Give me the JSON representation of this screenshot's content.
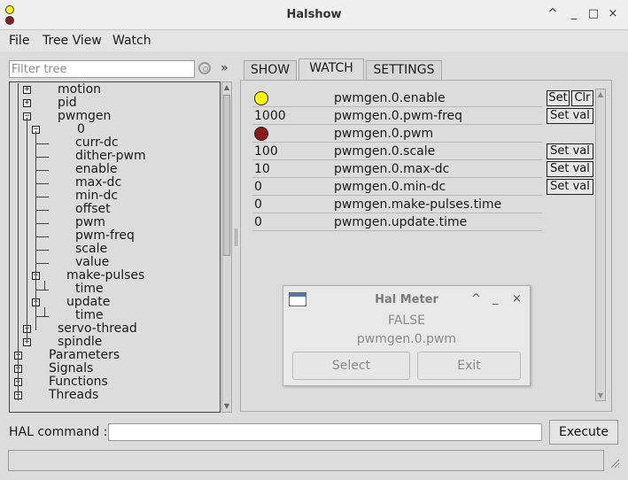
{
  "window": {
    "title": "Halshow",
    "controls": {
      "minimize": "^",
      "restore": "_",
      "maximize": "□",
      "close": "×"
    }
  },
  "menu": {
    "file": "File",
    "tree_view": "Tree View",
    "watch": "Watch"
  },
  "filter": {
    "placeholder": "Filter tree",
    "expand_glyph": "»"
  },
  "tree": [
    {
      "label": "motion",
      "expander": "+"
    },
    {
      "label": "pid",
      "expander": "+"
    },
    {
      "label": "pwmgen",
      "expander": "−"
    },
    {
      "label": "0",
      "expander": "−"
    },
    {
      "label": "curr-dc"
    },
    {
      "label": "dither-pwm"
    },
    {
      "label": "enable"
    },
    {
      "label": "max-dc"
    },
    {
      "label": "min-dc"
    },
    {
      "label": "offset"
    },
    {
      "label": "pwm"
    },
    {
      "label": "pwm-freq"
    },
    {
      "label": "scale"
    },
    {
      "label": "value"
    },
    {
      "label": "make-pulses",
      "expander": "−"
    },
    {
      "label": "time"
    },
    {
      "label": "update",
      "expander": "−"
    },
    {
      "label": "time"
    },
    {
      "label": "servo-thread",
      "expander": "+"
    },
    {
      "label": "spindle",
      "expander": "+"
    },
    {
      "label": "Parameters",
      "expander": "+"
    },
    {
      "label": "Signals",
      "expander": "+"
    },
    {
      "label": "Functions",
      "expander": "+"
    },
    {
      "label": "Threads",
      "expander": "+"
    }
  ],
  "tabs": {
    "show": "SHOW",
    "watch": "WATCH",
    "settings": "SETTINGS"
  },
  "watch": [
    {
      "value": "",
      "led": "#ffff00",
      "name": "pwmgen.0.enable",
      "buttons": [
        "Set",
        "Clr"
      ]
    },
    {
      "value": "1000",
      "name": "pwmgen.0.pwm-freq",
      "buttons": [
        "Set val"
      ]
    },
    {
      "value": "",
      "led": "#8b1a1a",
      "name": "pwmgen.0.pwm",
      "buttons": []
    },
    {
      "value": "100",
      "name": "pwmgen.0.scale",
      "buttons": [
        "Set val"
      ]
    },
    {
      "value": "10",
      "name": "pwmgen.0.max-dc",
      "buttons": [
        "Set val"
      ]
    },
    {
      "value": "0",
      "name": "pwmgen.0.min-dc",
      "buttons": [
        "Set val"
      ]
    },
    {
      "value": "0",
      "name": "pwmgen.make-pulses.time",
      "buttons": []
    },
    {
      "value": "0",
      "name": "pwmgen.update.time",
      "buttons": []
    }
  ],
  "meter": {
    "title": "Hal Meter",
    "value": "FALSE",
    "pin": "pwmgen.0.pwm",
    "select_label": "Select",
    "exit_label": "Exit",
    "controls": {
      "minimize": "^",
      "restore": "_",
      "close": "×"
    }
  },
  "bottom": {
    "hal_command_label": "HAL command :",
    "hal_command_value": "",
    "execute_label": "Execute",
    "status_text": ""
  }
}
